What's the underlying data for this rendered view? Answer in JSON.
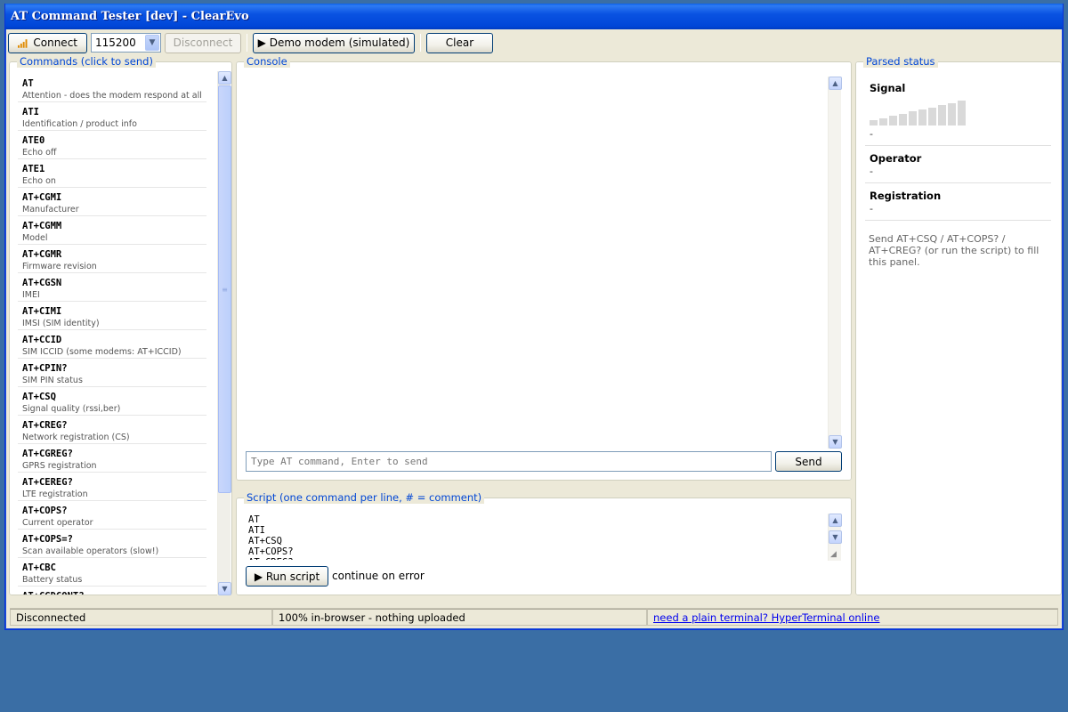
{
  "window": {
    "title": "AT Command Tester [dev] - ClearEvo"
  },
  "toolbar": {
    "connect_label": "Connect",
    "baud_value": "115200",
    "disconnect_label": "Disconnect",
    "demo_label": "▶ Demo modem (simulated)",
    "clear_label": "Clear"
  },
  "commands": {
    "title": "Commands (click to send)",
    "items": [
      {
        "code": "AT",
        "desc": "Attention - does the modem respond at all"
      },
      {
        "code": "ATI",
        "desc": "Identification / product info"
      },
      {
        "code": "ATE0",
        "desc": "Echo off"
      },
      {
        "code": "ATE1",
        "desc": "Echo on"
      },
      {
        "code": "AT+CGMI",
        "desc": "Manufacturer"
      },
      {
        "code": "AT+CGMM",
        "desc": "Model"
      },
      {
        "code": "AT+CGMR",
        "desc": "Firmware revision"
      },
      {
        "code": "AT+CGSN",
        "desc": "IMEI"
      },
      {
        "code": "AT+CIMI",
        "desc": "IMSI (SIM identity)"
      },
      {
        "code": "AT+CCID",
        "desc": "SIM ICCID (some modems: AT+ICCID)"
      },
      {
        "code": "AT+CPIN?",
        "desc": "SIM PIN status"
      },
      {
        "code": "AT+CSQ",
        "desc": "Signal quality (rssi,ber)"
      },
      {
        "code": "AT+CREG?",
        "desc": "Network registration (CS)"
      },
      {
        "code": "AT+CGREG?",
        "desc": "GPRS registration"
      },
      {
        "code": "AT+CEREG?",
        "desc": "LTE registration"
      },
      {
        "code": "AT+COPS?",
        "desc": "Current operator"
      },
      {
        "code": "AT+COPS=?",
        "desc": "Scan available operators (slow!)"
      },
      {
        "code": "AT+CBC",
        "desc": "Battery status"
      },
      {
        "code": "AT+CGDCONT?",
        "desc": ""
      }
    ]
  },
  "console": {
    "title": "Console",
    "input_placeholder": "Type AT command, Enter to send",
    "send_label": "Send"
  },
  "script": {
    "title": "Script (one command per line, # = comment)",
    "text": "AT\nATI\nAT+CSQ\nAT+COPS?\nAT+CREG?",
    "run_label": "▶ Run script",
    "continue_label": "continue on error"
  },
  "parsed": {
    "title": "Parsed status",
    "signal_label": "Signal",
    "signal_value": "-",
    "signal_bars_lit": 0,
    "operator_label": "Operator",
    "operator_value": "-",
    "registration_label": "Registration",
    "registration_value": "-",
    "hint": "Send AT+CSQ / AT+COPS? / AT+CREG? (or run the script) to fill this panel."
  },
  "statusbar": {
    "connection": "Disconnected",
    "privacy": "100% in-browser - nothing uploaded",
    "link": "need a plain terminal? HyperTerminal online"
  },
  "colors": {
    "desktop": "#3a6ea5",
    "title_accent": "#0046d5",
    "window_bg": "#ece9d8"
  },
  "icons": {
    "connect": "signal-icon"
  }
}
